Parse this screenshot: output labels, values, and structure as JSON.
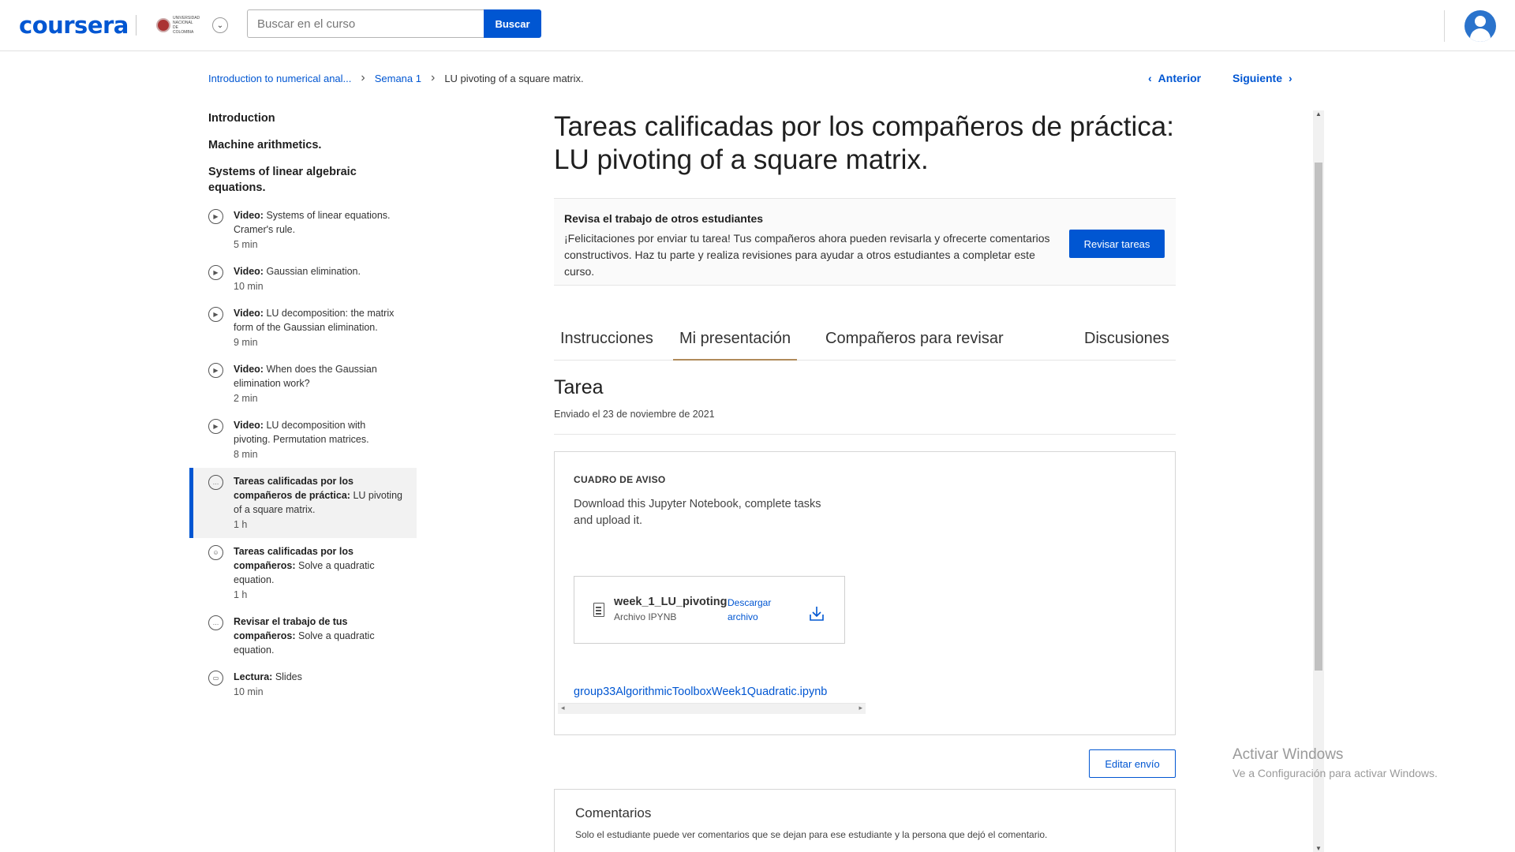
{
  "header": {
    "logo": "coursera",
    "university_logo_text": "UNIVERSIDAD NACIONAL DE COLOMBIA",
    "search_placeholder": "Buscar en el curso",
    "search_button": "Buscar"
  },
  "breadcrumb": {
    "items": [
      "Introduction to numerical anal...",
      "Semana 1"
    ],
    "current": "LU pivoting of a square matrix."
  },
  "nav": {
    "prev": "Anterior",
    "next": "Siguiente"
  },
  "sidebar": {
    "sections": [
      "Introduction",
      "Machine arithmetics.",
      "Systems of linear algebraic equations."
    ],
    "items": [
      {
        "type": "Video:",
        "title": "Systems of linear equations. Cramer's rule.",
        "duration": "5 min"
      },
      {
        "type": "Video:",
        "title": "Gaussian elimination.",
        "duration": "10 min"
      },
      {
        "type": "Video:",
        "title": "LU decomposition: the matrix form of the Gaussian elimination.",
        "duration": "9 min"
      },
      {
        "type": "Video:",
        "title": "When does the Gaussian elimination work?",
        "duration": "2 min"
      },
      {
        "type": "Video:",
        "title": "LU decomposition with pivoting. Permutation matrices.",
        "duration": "8 min"
      },
      {
        "type": "Tareas calificadas por los compañeros de práctica:",
        "title": "LU pivoting of a square matrix.",
        "duration": "1 h"
      },
      {
        "type": "Tareas calificadas por los compañeros:",
        "title": "Solve a quadratic equation.",
        "duration": "1 h"
      },
      {
        "type": "Revisar el trabajo de tus compañeros:",
        "title": "Solve a quadratic equation.",
        "duration": ""
      },
      {
        "type": "Lectura:",
        "title": "Slides",
        "duration": "10 min"
      }
    ]
  },
  "main": {
    "title": "Tareas calificadas por los compañeros de práctica: LU pivoting of a square matrix.",
    "notice": {
      "title": "Revisa el trabajo de otros estudiantes",
      "body": "¡Felicitaciones por enviar tu tarea! Tus compañeros ahora pueden revisarla y ofrecerte comentarios constructivos. Haz tu parte y realiza revisiones para ayudar a otros estudiantes a completar este curso.",
      "button": "Revisar tareas"
    },
    "tabs": [
      "Instrucciones",
      "Mi presentación",
      "Compañeros para revisar",
      "Discusiones"
    ],
    "task_title": "Tarea",
    "task_date": "Enviado el 23 de noviembre de 2021",
    "card": {
      "label": "CUADRO DE AVISO",
      "text": "Download this Jupyter Notebook, complete tasks and upload it.",
      "file_name": "week_1_LU_pivoting",
      "file_type": "Archivo IPYNB",
      "download_label": "Descargar archivo",
      "link": "group33AlgorithmicToolboxWeek1Quadratic.ipynb"
    },
    "edit_button": "Editar envío",
    "comments": {
      "title": "Comentarios",
      "text": "Solo el estudiante puede ver comentarios que se dejan para ese estudiante y la persona que dejó el comentario."
    }
  },
  "watermark": {
    "line1": "Activar Windows",
    "line2": "Ve a Configuración para activar Windows."
  },
  "colors": {
    "accent": "#0056d2",
    "tab_underline": "#b08a5a"
  }
}
